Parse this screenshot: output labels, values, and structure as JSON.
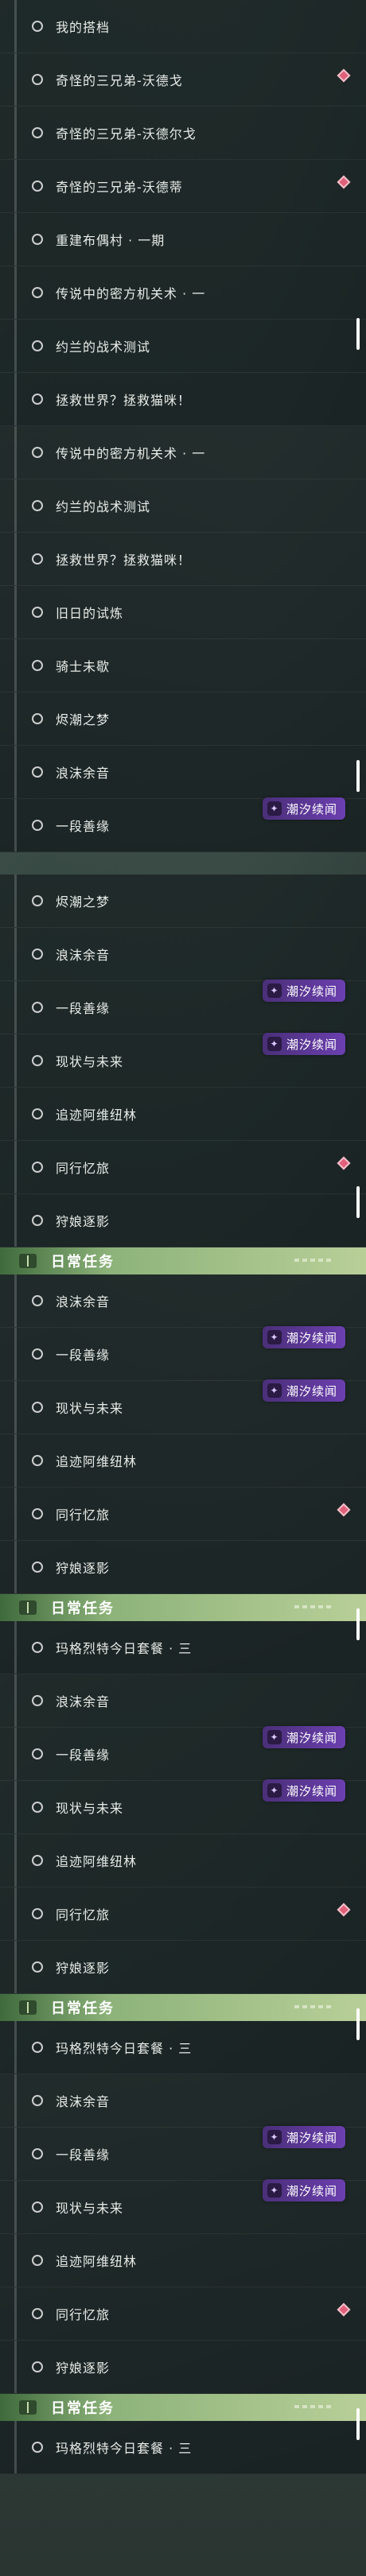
{
  "badge_text": "潮汐续闻",
  "header_title": "日常任务",
  "sections": [
    {
      "rows": [
        "我的搭档",
        "奇怪的三兄弟-沃德戈",
        "奇怪的三兄弟-沃德尔戈",
        "奇怪的三兄弟-沃德蒂",
        "重建布偶村 · 一期",
        "传说中的密方机关术 · 一",
        "约兰的战术测试",
        "拯救世界？拯救猫咪！"
      ]
    },
    {
      "rows": [
        "传说中的密方机关术 · 一",
        "约兰的战术测试",
        "拯救世界？拯救猫咪！",
        "旧日的试炼",
        "骑士未歇",
        "烬潮之梦",
        "浪沫余音",
        "一段善缘"
      ]
    },
    {
      "rows": [
        "烬潮之梦",
        "浪沫余音",
        "一段善缘",
        "现状与未来",
        "追迹阿维纽林",
        "同行忆旅",
        "狩娘逐影"
      ]
    },
    {
      "rows": [
        "浪沫余音",
        "一段善缘",
        "现状与未来",
        "追迹阿维纽林",
        "同行忆旅",
        "狩娘逐影"
      ],
      "footer": "玛格烈特今日套餐 · 三"
    },
    {
      "rows": [
        "浪沫余音",
        "一段善缘",
        "现状与未来",
        "追迹阿维纽林",
        "同行忆旅",
        "狩娘逐影"
      ],
      "footer": "玛格烈特今日套餐 · 三"
    },
    {
      "rows": [
        "浪沫余音",
        "一段善缘",
        "现状与未来",
        "追迹阿维纽林",
        "同行忆旅",
        "狩娘逐影"
      ],
      "footer": "玛格烈特今日套餐 · 三"
    }
  ]
}
